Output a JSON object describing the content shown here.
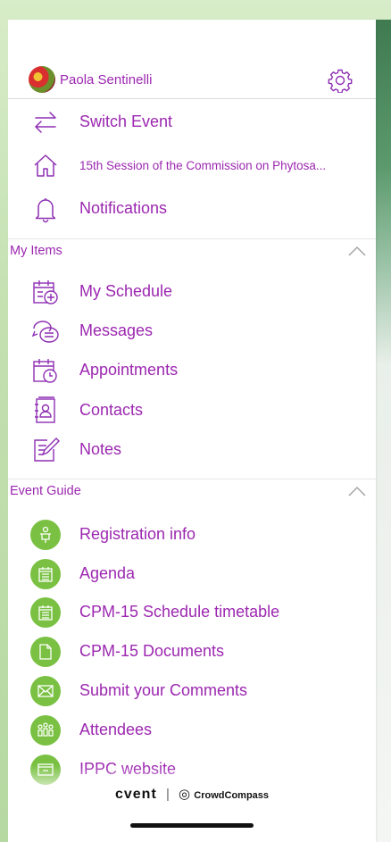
{
  "profile": {
    "name": "Paola Sentinelli",
    "avatar_icon": "avatar-flowers",
    "settings_icon": "gear-icon"
  },
  "top_items": [
    {
      "label": "Switch Event",
      "icon": "switch-arrows-icon"
    },
    {
      "label": "15th Session of the Commission on Phytosa...",
      "icon": "home-icon"
    },
    {
      "label": "Notifications",
      "icon": "bell-icon"
    }
  ],
  "my_items": {
    "title": "My Items",
    "items": [
      {
        "label": "My Schedule",
        "icon": "calendar-add-icon"
      },
      {
        "label": "Messages",
        "icon": "chat-bubbles-icon"
      },
      {
        "label": "Appointments",
        "icon": "calendar-clock-icon"
      },
      {
        "label": "Contacts",
        "icon": "address-book-icon"
      },
      {
        "label": "Notes",
        "icon": "note-pencil-icon"
      }
    ]
  },
  "event_guide": {
    "title": "Event Guide",
    "items": [
      {
        "label": "Registration info",
        "icon": "registration-icon"
      },
      {
        "label": "Agenda",
        "icon": "agenda-icon"
      },
      {
        "label": "CPM-15  Schedule timetable",
        "icon": "timetable-icon"
      },
      {
        "label": "CPM-15 Documents",
        "icon": "document-icon"
      },
      {
        "label": "Submit your Comments",
        "icon": "envelope-icon"
      },
      {
        "label": "Attendees",
        "icon": "attendees-icon"
      },
      {
        "label": "IPPC website",
        "icon": "website-icon"
      }
    ]
  },
  "footer": {
    "brand_left": "cvent",
    "brand_right": "CrowdCompass"
  },
  "colors": {
    "accent": "#9c27b0",
    "icon_purple": "#8e2fb3",
    "guide_green": "#7ac143",
    "background_green": "#c3e0b0"
  }
}
